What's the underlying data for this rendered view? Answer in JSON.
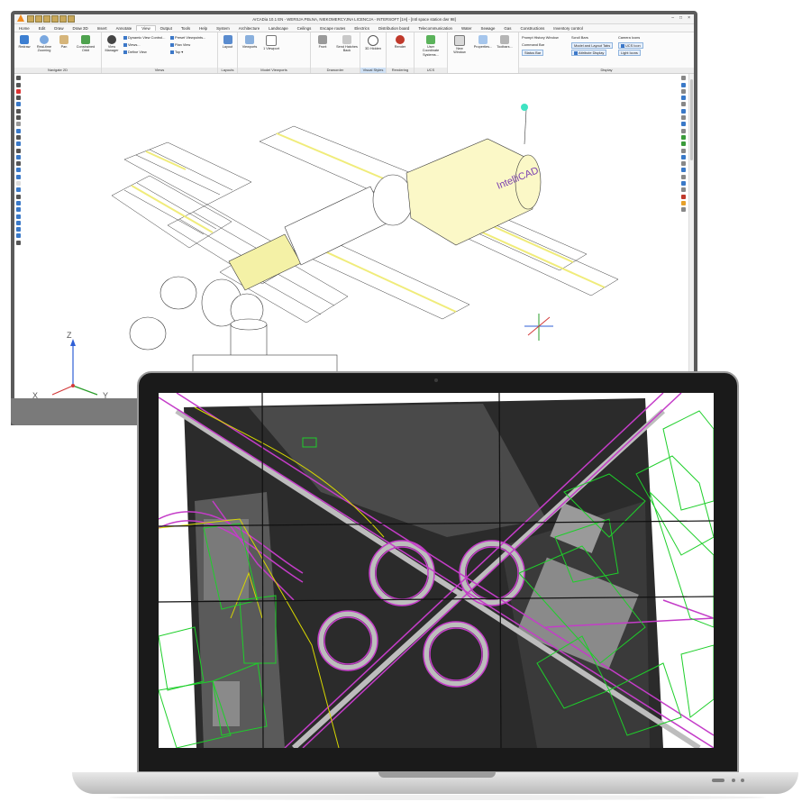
{
  "monitor": {
    "title": "ArCADia 10.1 EN - WERSJA PEŁNA, NIEKOMERCYJNA LICENCJA - INTERSOFT [1H] - [Intl space station dwr 98]",
    "window_controls": [
      "–",
      "□",
      "×"
    ],
    "menu_tabs": [
      "Home",
      "Edit",
      "Draw",
      "Draw 3D",
      "Insert",
      "Annotate",
      "View",
      "Output",
      "Tools",
      "Help",
      "System",
      "Architecture",
      "Landscape",
      "Ceilings",
      "Escape routes",
      "Electrics",
      "Distribution board",
      "Telecommunication",
      "Water",
      "Sewage",
      "Gas",
      "Constructions",
      "Inventory control"
    ],
    "active_tab": "View",
    "ribbon": {
      "navigate": {
        "label": "Navigate 2D",
        "buttons": [
          "Redraw",
          "Real-time Zooming",
          "Pan",
          "Constrained Orbit"
        ]
      },
      "views": {
        "label": "Views",
        "view_manager": "View Manager",
        "items": [
          "Dynamic View Control...",
          "Views...",
          "Define View",
          "Preset Viewpoints...",
          "Plan View",
          "Top"
        ]
      },
      "layouts": {
        "label": "Layouts",
        "button": "Layout"
      },
      "model_viewports": {
        "label": "Model Viewports",
        "buttons": [
          "Viewports",
          "1 Viewport"
        ]
      },
      "draworder": {
        "label": "Draworder",
        "buttons": [
          "Front",
          "Send Hatches Back"
        ]
      },
      "visual_styles": {
        "label": "Visual Styles",
        "button": "3D Hidden"
      },
      "rendering": {
        "label": "Rendering",
        "button": "Render"
      },
      "ucs": {
        "label": "UCS",
        "button": "User Coordinate Systems..."
      },
      "window": {
        "buttons": [
          "New Window",
          "Properties...",
          "Toolbars..."
        ]
      },
      "display": {
        "label": "Display",
        "col1": [
          "Prompt History Window",
          "Command Bar",
          "Status Bar"
        ],
        "col2": [
          "Scroll Bars",
          "Model and Layout Tabs",
          "Attribute Display"
        ],
        "col3": [
          "Camera Icons",
          "UCS Icon",
          "Light Icons"
        ]
      }
    },
    "canvas": {
      "logo_text": "IntelliCAD",
      "ucs_labels": {
        "z": "Z",
        "x": "X",
        "y": "Y"
      },
      "colors": {
        "wireframe": "#3a3a3a",
        "highlight": "#f2ef9a",
        "panel": "#7a7a7a",
        "ucs_x": "#d23a3a",
        "ucs_y": "#2a9d2a",
        "ucs_z": "#2f5fd6"
      }
    }
  },
  "laptop": {
    "content": "Aerial map of a cloverleaf highway interchange with CAD overlay",
    "colors": {
      "roads_overlay": "#c43cc8",
      "buildings_overlay": "#1ecf2a",
      "boundary": "#d7d700",
      "grid": "#111111"
    }
  }
}
